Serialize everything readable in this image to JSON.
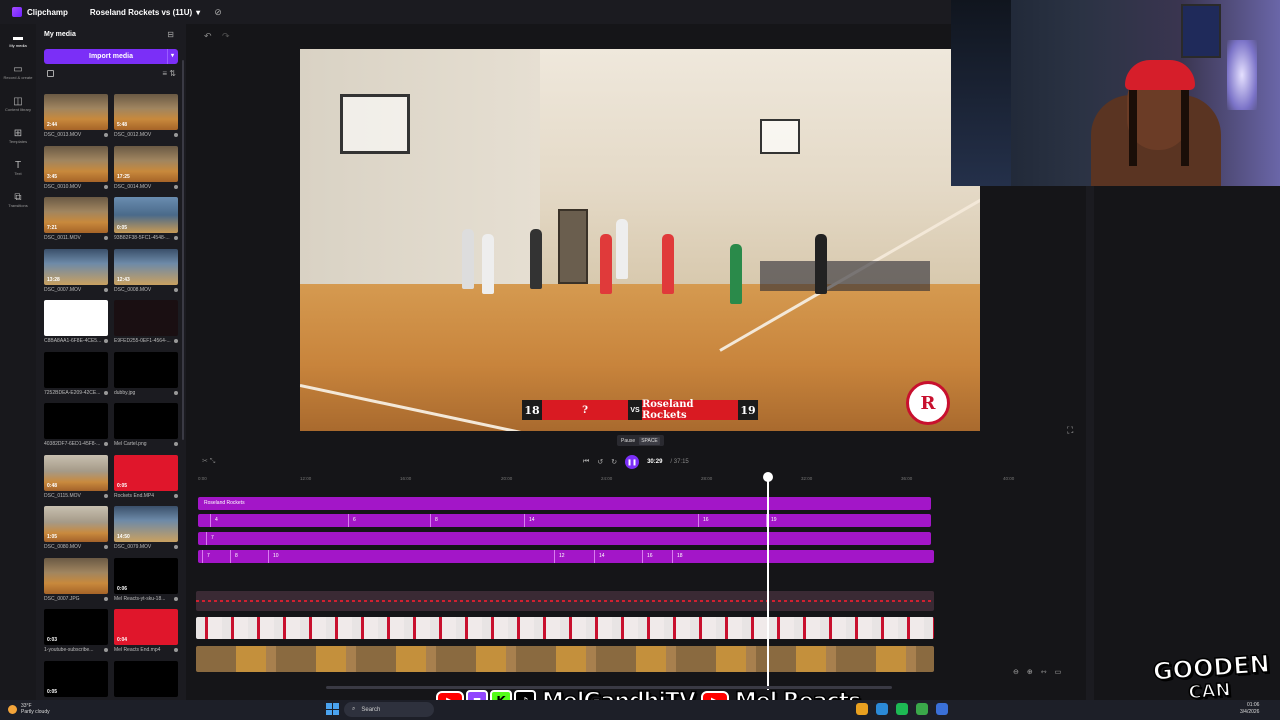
{
  "titlebar": {
    "app_name": "Clipchamp",
    "project_name": "Roseland Rockets vs (11U)"
  },
  "rail": [
    {
      "label": "My media",
      "icon": "folder-icon"
    },
    {
      "label": "Record & create",
      "icon": "camera-icon"
    },
    {
      "label": "Content library",
      "icon": "library-icon"
    },
    {
      "label": "Templates",
      "icon": "templates-icon"
    },
    {
      "label": "Text",
      "icon": "text-icon"
    },
    {
      "label": "Transitions",
      "icon": "transitions-icon"
    }
  ],
  "media": {
    "title": "My media",
    "import_label": "Import media",
    "items": [
      {
        "name": "DSC_0013.MOV",
        "duration": "2:44",
        "style": "t-gym"
      },
      {
        "name": "DSC_0012.MOV",
        "duration": "5:48",
        "style": "t-gym"
      },
      {
        "name": "DSC_0010.MOV",
        "duration": "3:45",
        "style": "t-gym"
      },
      {
        "name": "DSC_0014.MOV",
        "duration": "17:25",
        "style": "t-gym"
      },
      {
        "name": "DSC_0011.MOV",
        "duration": "7:21",
        "style": "t-gym"
      },
      {
        "name": "93B82F38-5FC1-4548-...",
        "duration": "0:05",
        "style": "t-blue"
      },
      {
        "name": "DSC_0007.MOV",
        "duration": "13:28",
        "style": "t-court"
      },
      {
        "name": "DSC_0008.MOV",
        "duration": "12:43",
        "style": "t-court"
      },
      {
        "name": "C8BA8AA1-6F8E-4CE5...",
        "duration": "",
        "style": "t-white"
      },
      {
        "name": "E9FED255-0EF1-4564-...",
        "duration": "",
        "style": "t-dark"
      },
      {
        "name": "7252BDEA-E209-42CE...",
        "duration": "",
        "style": "t-black"
      },
      {
        "name": "dubby.jpg",
        "duration": "",
        "style": "t-yellow"
      },
      {
        "name": "40382DF7-6ED1-45F8-...",
        "duration": "",
        "style": "t-black"
      },
      {
        "name": "Mel Cartel.png",
        "duration": "",
        "style": "t-black"
      },
      {
        "name": "DSC_0115.MOV",
        "duration": "0:48",
        "style": "t-gym2"
      },
      {
        "name": "Rockets End.MP4",
        "duration": "0:05",
        "style": "t-red"
      },
      {
        "name": "DSC_0080.MOV",
        "duration": "1:05",
        "style": "t-gym2"
      },
      {
        "name": "DSC_0079.MOV",
        "duration": "14:50",
        "style": "t-court"
      },
      {
        "name": "DSC_0007.JPG",
        "duration": "",
        "style": "t-gym"
      },
      {
        "name": "Mel Reacts-yt-sku-18...",
        "duration": "0:06",
        "style": "t-black"
      },
      {
        "name": "1-youtube-subscribe...",
        "duration": "0:03",
        "style": "t-black"
      },
      {
        "name": "Mel Reacts End.mp4",
        "duration": "0:04",
        "style": "t-red"
      },
      {
        "name": "",
        "duration": "0:05",
        "style": "t-black"
      },
      {
        "name": "",
        "duration": "",
        "style": "t-black"
      }
    ]
  },
  "preview": {
    "score_left": "18",
    "team_left": "?",
    "vs": "VS",
    "team_right": "Roseland Rockets",
    "score_right": "19",
    "logo_letter": "R",
    "tooltip_label": "Pause",
    "tooltip_key": "SPACE"
  },
  "transport": {
    "current": "30:29",
    "total": "/ 37:15"
  },
  "ruler": [
    "0:00",
    "12:00",
    "16:00",
    "20:00",
    "24:00",
    "28:00",
    "32:00",
    "36:00",
    "40:00"
  ],
  "tracks": {
    "title_track": "Roseland Rockets",
    "row2": [
      "4",
      "6",
      "8",
      "14",
      "16",
      "19"
    ],
    "row3": [
      "7"
    ],
    "row4": [
      "7",
      "8",
      "10",
      "12",
      "14",
      "16",
      "18"
    ]
  },
  "overlay": {
    "channel_name": "MelGandhiTV",
    "channel_name_2": "Mel Reacts",
    "watermark_line1": "GOODEN",
    "watermark_line2": "CAN"
  },
  "taskbar": {
    "temp": "33°F",
    "weather": "Partly cloudy",
    "search": "Search",
    "time": "01:06",
    "date": "3/4/2026"
  },
  "colors": {
    "accent": "#7b2ff7",
    "track": "#a316c8",
    "scorebug_red": "#d91a22"
  }
}
